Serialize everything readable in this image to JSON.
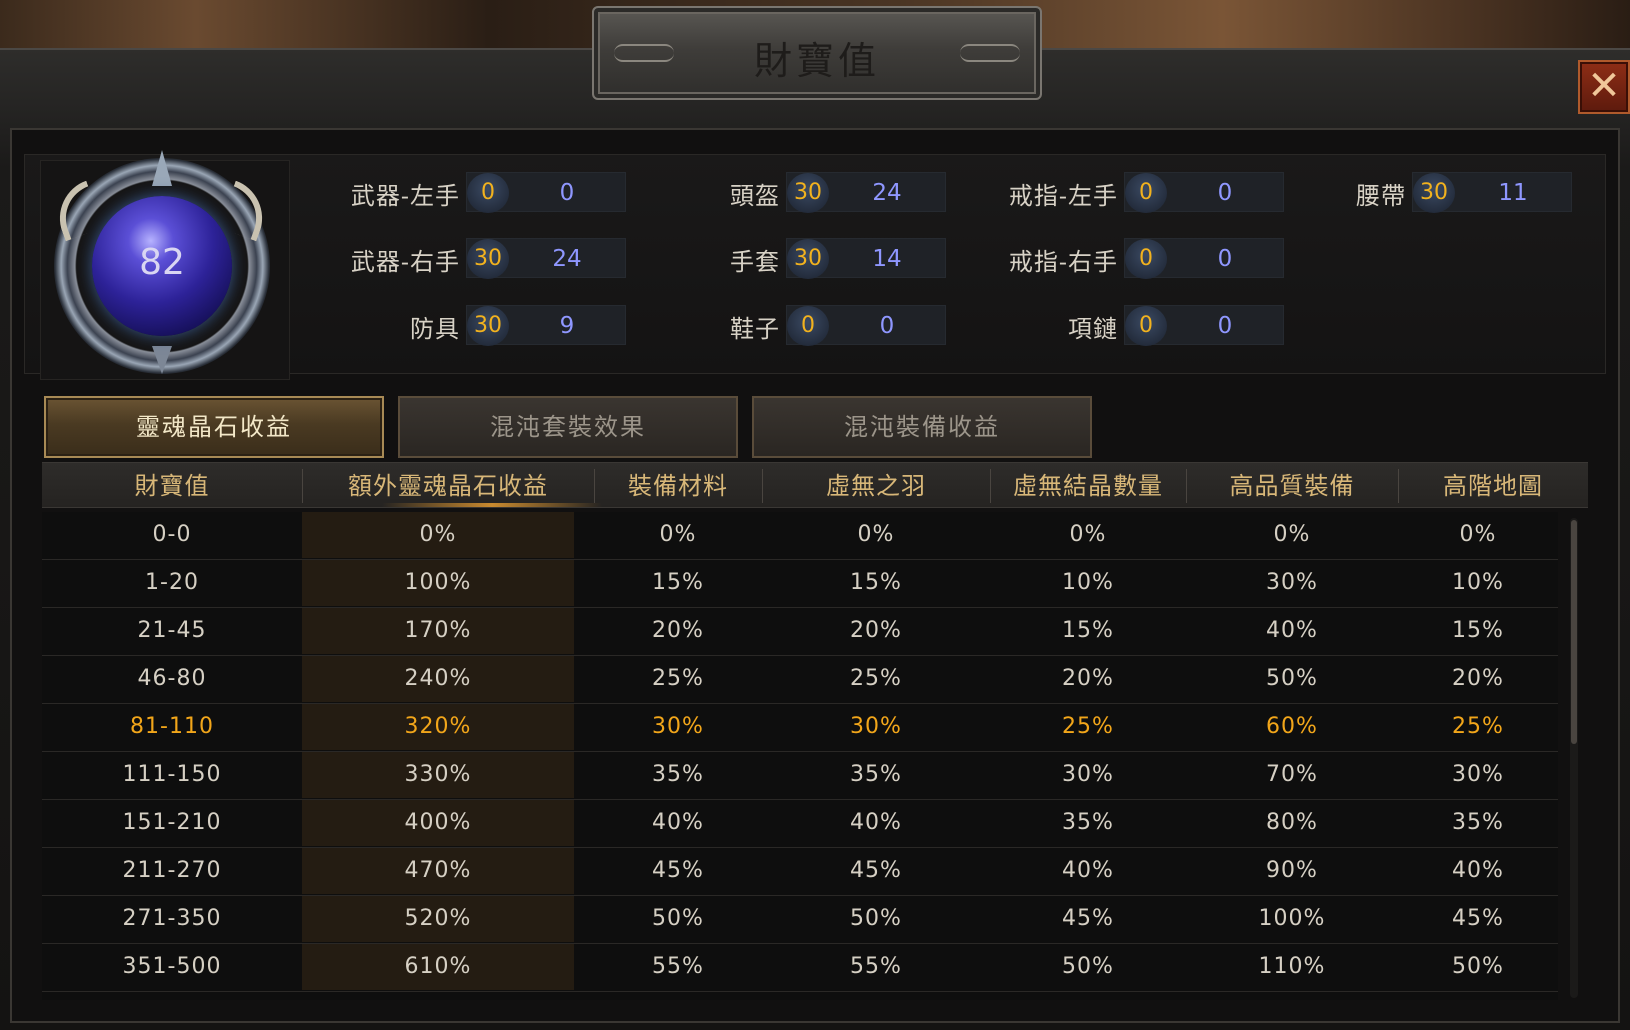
{
  "title": "財寶值",
  "close_label": "✕",
  "orb_value": "82",
  "slots": {
    "weapon_left": {
      "label": "武器-左手",
      "badge": "0",
      "value": "0"
    },
    "weapon_right": {
      "label": "武器-右手",
      "badge": "30",
      "value": "24"
    },
    "armor": {
      "label": "防具",
      "badge": "30",
      "value": "9"
    },
    "helmet": {
      "label": "頭盔",
      "badge": "30",
      "value": "24"
    },
    "gloves": {
      "label": "手套",
      "badge": "30",
      "value": "14"
    },
    "boots": {
      "label": "鞋子",
      "badge": "0",
      "value": "0"
    },
    "ring_left": {
      "label": "戒指-左手",
      "badge": "0",
      "value": "0"
    },
    "ring_right": {
      "label": "戒指-右手",
      "badge": "0",
      "value": "0"
    },
    "necklace": {
      "label": "項鏈",
      "badge": "0",
      "value": "0"
    },
    "belt": {
      "label": "腰帶",
      "badge": "30",
      "value": "11"
    }
  },
  "tabs": [
    {
      "label": "靈魂晶石收益",
      "active": true
    },
    {
      "label": "混沌套裝效果",
      "active": false
    },
    {
      "label": "混沌裝備收益",
      "active": false
    }
  ],
  "table": {
    "headers": [
      "財寶值",
      "額外靈魂晶石收益",
      "裝備材料",
      "虛無之羽",
      "虛無結晶數量",
      "高品質裝備",
      "高階地圖"
    ],
    "rows": [
      [
        "0-0",
        "0%",
        "0%",
        "0%",
        "0%",
        "0%",
        "0%"
      ],
      [
        "1-20",
        "100%",
        "15%",
        "15%",
        "10%",
        "30%",
        "10%"
      ],
      [
        "21-45",
        "170%",
        "20%",
        "20%",
        "15%",
        "40%",
        "15%"
      ],
      [
        "46-80",
        "240%",
        "25%",
        "25%",
        "20%",
        "50%",
        "20%"
      ],
      [
        "81-110",
        "320%",
        "30%",
        "30%",
        "25%",
        "60%",
        "25%"
      ],
      [
        "111-150",
        "330%",
        "35%",
        "35%",
        "30%",
        "70%",
        "30%"
      ],
      [
        "151-210",
        "400%",
        "40%",
        "40%",
        "35%",
        "80%",
        "35%"
      ],
      [
        "211-270",
        "470%",
        "45%",
        "45%",
        "40%",
        "90%",
        "40%"
      ],
      [
        "271-350",
        "520%",
        "50%",
        "50%",
        "45%",
        "100%",
        "45%"
      ],
      [
        "351-500",
        "610%",
        "55%",
        "55%",
        "50%",
        "110%",
        "50%"
      ]
    ],
    "current_row_index": 4,
    "colors": {
      "current_row": "#f2a61a",
      "header": "#d8b778",
      "badge_text": "#f2b21e",
      "slot_value": "#8f97ff"
    }
  }
}
